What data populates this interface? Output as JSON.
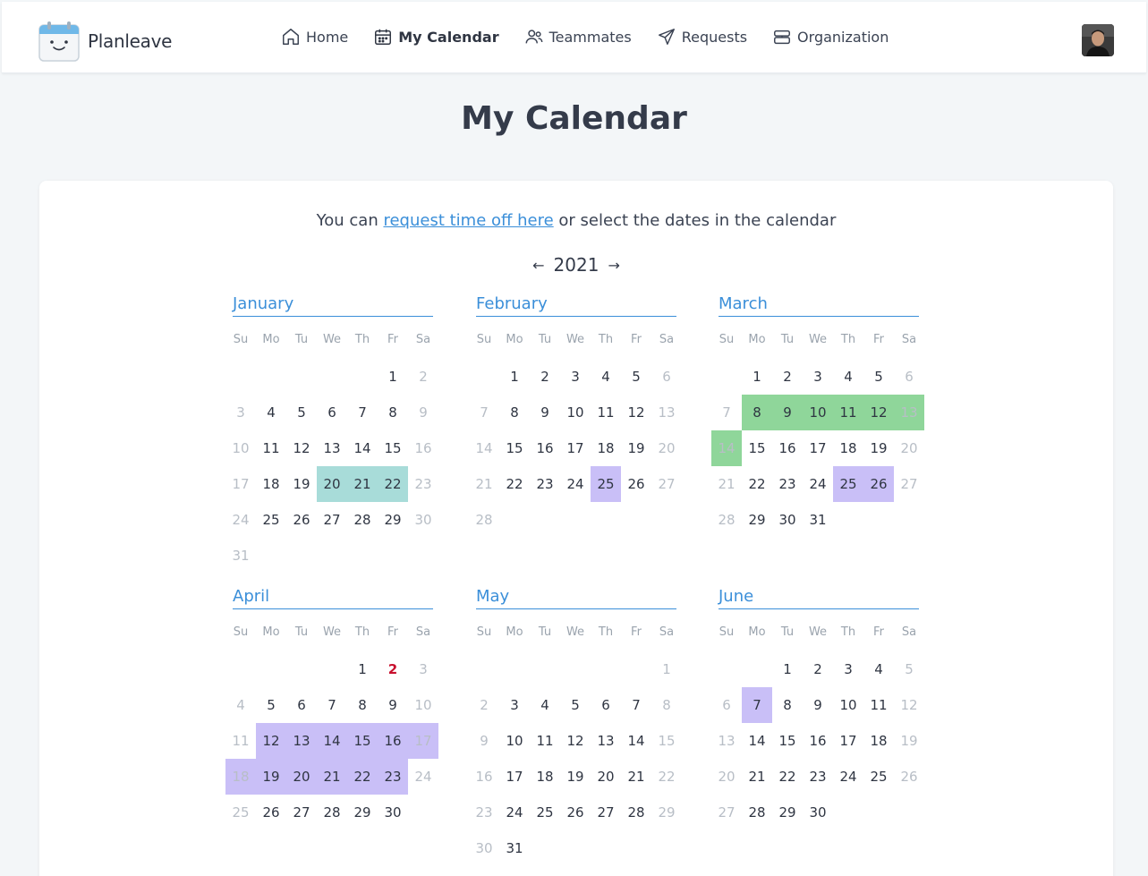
{
  "app": {
    "name": "Planleave"
  },
  "nav": [
    {
      "label": "Home",
      "icon": "home-icon",
      "active": false
    },
    {
      "label": "My Calendar",
      "icon": "calendar-icon",
      "active": true
    },
    {
      "label": "Teammates",
      "icon": "users-icon",
      "active": false
    },
    {
      "label": "Requests",
      "icon": "send-icon",
      "active": false
    },
    {
      "label": "Organization",
      "icon": "organization-icon",
      "active": false
    }
  ],
  "page": {
    "title": "My Calendar"
  },
  "intro": {
    "prefix": "You can ",
    "link": "request time off here",
    "suffix": " or select the dates in the calendar"
  },
  "year_nav": {
    "year": "2021",
    "prev": "←",
    "next": "→"
  },
  "weekdays": [
    "Su",
    "Mo",
    "Tu",
    "We",
    "Th",
    "Fr",
    "Sa"
  ],
  "colors": {
    "teal": "#a8dcd9",
    "purple": "#c9bff7",
    "green": "#8fd69a",
    "holiday": "#c8102e",
    "accent": "#3b8fd9"
  },
  "months": [
    {
      "name": "January",
      "start": 5,
      "days": 31,
      "teal": [
        20,
        21,
        22
      ],
      "purple": [],
      "green": [],
      "holiday": []
    },
    {
      "name": "February",
      "start": 1,
      "days": 28,
      "teal": [],
      "purple": [
        25
      ],
      "green": [],
      "holiday": []
    },
    {
      "name": "March",
      "start": 1,
      "days": 31,
      "teal": [],
      "purple": [
        25,
        26
      ],
      "green": [
        8,
        9,
        10,
        11,
        12,
        13,
        14
      ],
      "holiday": []
    },
    {
      "name": "April",
      "start": 4,
      "days": 30,
      "teal": [],
      "purple": [
        12,
        13,
        14,
        15,
        16,
        17,
        18,
        19,
        20,
        21,
        22,
        23
      ],
      "green": [],
      "holiday": [
        2
      ]
    },
    {
      "name": "May",
      "start": 6,
      "days": 31,
      "teal": [],
      "purple": [],
      "green": [],
      "holiday": []
    },
    {
      "name": "June",
      "start": 2,
      "days": 30,
      "teal": [],
      "purple": [
        7
      ],
      "green": [],
      "holiday": []
    }
  ]
}
